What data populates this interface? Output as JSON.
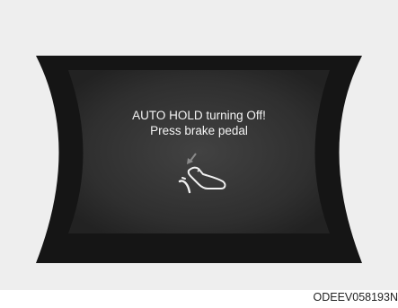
{
  "message": {
    "line1": "AUTO HOLD turning Off!",
    "line2": "Press brake pedal"
  },
  "icon": "brake-pedal-icon",
  "figure_code": "ODEEV058193N",
  "colors": {
    "panel_bg": "#eeeeee",
    "bezel": "#151515",
    "screen_center": "#3c3c3c",
    "screen_edge": "#242424",
    "text": "#f4f4f4"
  }
}
